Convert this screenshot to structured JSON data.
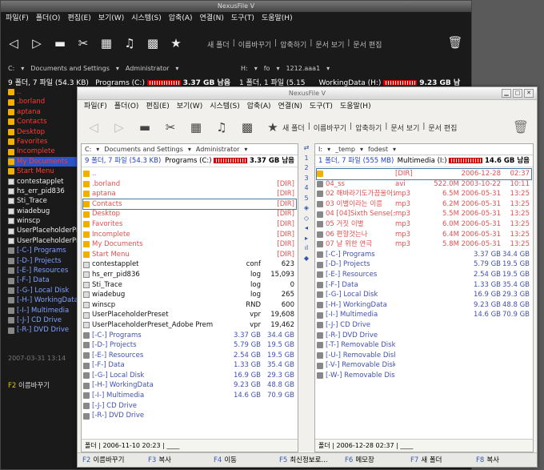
{
  "back_window": {
    "title": "NexusFile V",
    "menu": [
      "파일(F)",
      "폴더(O)",
      "편집(E)",
      "보기(W)",
      "시스템(S)",
      "압축(A)",
      "연결(N)",
      "도구(T)",
      "도움말(H)"
    ],
    "toolbar_links": [
      "새 폴더",
      "이름바꾸기",
      "압축하기",
      "문서 보기",
      "문서 편집"
    ],
    "left_path": [
      "C:",
      "Documents and Settings",
      "Administrator"
    ],
    "left_summary": {
      "count": "9 폴더, 7 파일 (54.3 KB)",
      "drive": "Programs (C:)",
      "free": "3.37 GB 남음"
    },
    "right_path": [
      "H:",
      "fo",
      "1212.aaa1"
    ],
    "right_summary": {
      "count": "1 폴더, 1 파일 (5.15 KB)",
      "drive": "WorkingData (H:)",
      "free": "9.23 GB 남음"
    },
    "items": [
      {
        "name": "..",
        "kind": "up"
      },
      {
        "name": ".borland",
        "kind": "folder"
      },
      {
        "name": "aptana",
        "kind": "folder"
      },
      {
        "name": "Contacts",
        "kind": "folder"
      },
      {
        "name": "Desktop",
        "kind": "folder"
      },
      {
        "name": "Favorites",
        "kind": "folder"
      },
      {
        "name": "Incomplete",
        "kind": "folder"
      },
      {
        "name": "My Documents",
        "kind": "selected"
      },
      {
        "name": "Start Menu",
        "kind": "folder"
      },
      {
        "name": "contestapplet",
        "kind": "file"
      },
      {
        "name": "hs_err_pid836",
        "kind": "file"
      },
      {
        "name": "Sti_Trace",
        "kind": "file"
      },
      {
        "name": "wiadebug",
        "kind": "file"
      },
      {
        "name": "winscp",
        "kind": "file"
      },
      {
        "name": "UserPlaceholderPreset",
        "kind": "file"
      },
      {
        "name": "UserPlaceholderPreset_Adobe",
        "kind": "file"
      },
      {
        "name": "[-C-] Programs",
        "kind": "drive"
      },
      {
        "name": "[-D-] Projects",
        "kind": "drive"
      },
      {
        "name": "[-E-] Resources",
        "kind": "drive"
      },
      {
        "name": "[-F-] Data",
        "kind": "drive"
      },
      {
        "name": "[-G-] Local Disk",
        "kind": "drive"
      },
      {
        "name": "[-H-] WorkingData",
        "kind": "drive"
      },
      {
        "name": "[-I-] Multimedia",
        "kind": "drive"
      },
      {
        "name": "[-J-] CD Drive",
        "kind": "drive"
      },
      {
        "name": "[-R-] DVD Drive",
        "kind": "drive"
      }
    ],
    "status": "2007-03-31 13:14",
    "fkey": {
      "key": "F2",
      "label": "이름바꾸기"
    }
  },
  "front_window": {
    "title": "NexusFile V",
    "menu": [
      "파일(F)",
      "폴더(O)",
      "편집(E)",
      "보기(W)",
      "시스템(S)",
      "압축(A)",
      "연결(N)",
      "도구(T)",
      "도움말(H)"
    ],
    "toolbar_links": [
      "새 폴더",
      "이름바꾸기",
      "압축하기",
      "문서 보기",
      "문서 편집"
    ],
    "left": {
      "path": [
        "C:",
        "Documents and Settings",
        "Administrator"
      ],
      "summary": {
        "count": "9 폴더, 7 파일 (54.3 KB)",
        "drive": "Programs (C:)",
        "free": "3.37 GB 남음"
      },
      "rows": [
        {
          "name": "..",
          "c1": "",
          "c2": "",
          "kind": "up"
        },
        {
          "name": ".borland",
          "c1": "",
          "c2": "[DIR]",
          "kind": "folder"
        },
        {
          "name": "aptana",
          "c1": "",
          "c2": "[DIR]",
          "kind": "folder"
        },
        {
          "name": "Contacts",
          "c1": "",
          "c2": "[DIR]",
          "kind": "folder",
          "sel": true
        },
        {
          "name": "Desktop",
          "c1": "",
          "c2": "[DIR]",
          "kind": "folder"
        },
        {
          "name": "Favorites",
          "c1": "",
          "c2": "[DIR]",
          "kind": "folder"
        },
        {
          "name": "Incomplete",
          "c1": "",
          "c2": "[DIR]",
          "kind": "folder"
        },
        {
          "name": "My Documents",
          "c1": "",
          "c2": "[DIR]",
          "kind": "folder"
        },
        {
          "name": "Start Menu",
          "c1": "",
          "c2": "[DIR]",
          "kind": "folder"
        },
        {
          "name": "contestapplet",
          "c1": "conf",
          "c2": "623",
          "kind": "file"
        },
        {
          "name": "hs_err_pid836",
          "c1": "log",
          "c2": "15,093",
          "kind": "file"
        },
        {
          "name": "Sti_Trace",
          "c1": "log",
          "c2": "0",
          "kind": "file"
        },
        {
          "name": "wiadebug",
          "c1": "log",
          "c2": "265",
          "kind": "file"
        },
        {
          "name": "winscp",
          "c1": "RND",
          "c2": "600",
          "kind": "file"
        },
        {
          "name": "UserPlaceholderPreset",
          "c1": "vpr",
          "c2": "19,608",
          "kind": "file"
        },
        {
          "name": "UserPlaceholderPreset_Adobe Premiere 7.0",
          "c1": "vpr",
          "c2": "19,462",
          "kind": "file"
        },
        {
          "name": "[-C-] Programs",
          "c1": "3.37 GB",
          "c2": "34.4 GB",
          "kind": "drive"
        },
        {
          "name": "[-D-] Projects",
          "c1": "5.79 GB",
          "c2": "19.5 GB",
          "kind": "drive"
        },
        {
          "name": "[-E-] Resources",
          "c1": "2.54 GB",
          "c2": "19.5 GB",
          "kind": "drive"
        },
        {
          "name": "[-F-] Data",
          "c1": "1.33 GB",
          "c2": "35.4 GB",
          "kind": "drive"
        },
        {
          "name": "[-G-] Local Disk",
          "c1": "16.9 GB",
          "c2": "29.3 GB",
          "kind": "drive"
        },
        {
          "name": "[-H-] WorkingData",
          "c1": "9.23 GB",
          "c2": "48.8 GB",
          "kind": "drive"
        },
        {
          "name": "[-I-] Multimedia",
          "c1": "14.6 GB",
          "c2": "70.9 GB",
          "kind": "drive"
        },
        {
          "name": "[-J-] CD Drive",
          "c1": "",
          "c2": "",
          "kind": "cd"
        },
        {
          "name": "[-R-] DVD Drive",
          "c1": "",
          "c2": "",
          "kind": "cd"
        }
      ],
      "status": "폴더 | 2006-11-10 20:23 | ____"
    },
    "right": {
      "path": [
        "I:",
        "_temp",
        "fodest"
      ],
      "summary": {
        "count": "1 폴더, 7 파일 (555 MB)",
        "drive": "Multimedia (I:)",
        "free": "14.6 GB 남음"
      },
      "rows": [
        {
          "name": "",
          "c0": "[DIR]",
          "c1": "2006-12-28",
          "c2": "02:37",
          "kind": "folder",
          "sel": true
        },
        {
          "name": "04_ss",
          "c0": "avi",
          "c1": "522.0M 2003-10-22",
          "c2": "10:11",
          "kind": "media"
        },
        {
          "name": "02 해바라기도가끔울어요",
          "c0": "mp3",
          "c1": "6.5M 2006-05-31",
          "c2": "13:25",
          "kind": "media"
        },
        {
          "name": "03 이별이라는 이름",
          "c0": "mp3",
          "c1": "6.2M 2006-05-31",
          "c2": "13:25",
          "kind": "media"
        },
        {
          "name": "04 [04]Sixth Sense(스페",
          "c0": "mp3",
          "c1": "5.5M 2006-05-31",
          "c2": "13:25",
          "kind": "media"
        },
        {
          "name": "05 거짓 이별",
          "c0": "mp3",
          "c1": "6.0M 2006-05-31",
          "c2": "13:25",
          "kind": "media"
        },
        {
          "name": "06 편할것는나",
          "c0": "mp3",
          "c1": "6.4M 2006-05-31",
          "c2": "13:25",
          "kind": "media"
        },
        {
          "name": "07 날 위한 연극",
          "c0": "mp3",
          "c1": "5.8M 2006-05-31",
          "c2": "13:25",
          "kind": "media"
        },
        {
          "name": "[-C-] Programs",
          "c0": "",
          "c1": "3.37 GB",
          "c2": "34.4 GB",
          "kind": "drive"
        },
        {
          "name": "[-D-] Projects",
          "c0": "",
          "c1": "5.79 GB",
          "c2": "19.5 GB",
          "kind": "drive"
        },
        {
          "name": "[-E-] Resources",
          "c0": "",
          "c1": "2.54 GB",
          "c2": "19.5 GB",
          "kind": "drive"
        },
        {
          "name": "[-F-] Data",
          "c0": "",
          "c1": "1.33 GB",
          "c2": "35.4 GB",
          "kind": "drive"
        },
        {
          "name": "[-G-] Local Disk",
          "c0": "",
          "c1": "16.9 GB",
          "c2": "29.3 GB",
          "kind": "drive"
        },
        {
          "name": "[-H-] WorkingData",
          "c0": "",
          "c1": "9.23 GB",
          "c2": "48.8 GB",
          "kind": "drive"
        },
        {
          "name": "[-I-] Multimedia",
          "c0": "",
          "c1": "14.6 GB",
          "c2": "70.9 GB",
          "kind": "drive"
        },
        {
          "name": "[-J-] CD Drive",
          "c0": "",
          "c1": "",
          "c2": "",
          "kind": "cd"
        },
        {
          "name": "[-R-] DVD Drive",
          "c0": "",
          "c1": "",
          "c2": "",
          "kind": "cd"
        },
        {
          "name": "[-T-] Removable Disk",
          "c0": "",
          "c1": "",
          "c2": "",
          "kind": "cd"
        },
        {
          "name": "[-U-] Removable Disk",
          "c0": "",
          "c1": "",
          "c2": "",
          "kind": "cd"
        },
        {
          "name": "[-V-] Removable Disk",
          "c0": "",
          "c1": "",
          "c2": "",
          "kind": "cd"
        },
        {
          "name": "[-W-] Removable Disk",
          "c0": "",
          "c1": "",
          "c2": "",
          "kind": "cd"
        }
      ],
      "status": "폴더 | 2006-12-28 02:37 | ____"
    },
    "mid_buttons": [
      "⇄",
      "1",
      "2",
      "3",
      "4",
      "5",
      "◈",
      "◇",
      "◂",
      "▸",
      "ıl",
      "◆"
    ],
    "fkeys": [
      {
        "key": "F2",
        "label": "이름바꾸기"
      },
      {
        "key": "F3",
        "label": "복사"
      },
      {
        "key": "F4",
        "label": "이동"
      },
      {
        "key": "F5",
        "label": "최신정보로..."
      },
      {
        "key": "F6",
        "label": "메모장"
      },
      {
        "key": "F7",
        "label": "새 폴더"
      },
      {
        "key": "F8",
        "label": "복사"
      }
    ]
  }
}
